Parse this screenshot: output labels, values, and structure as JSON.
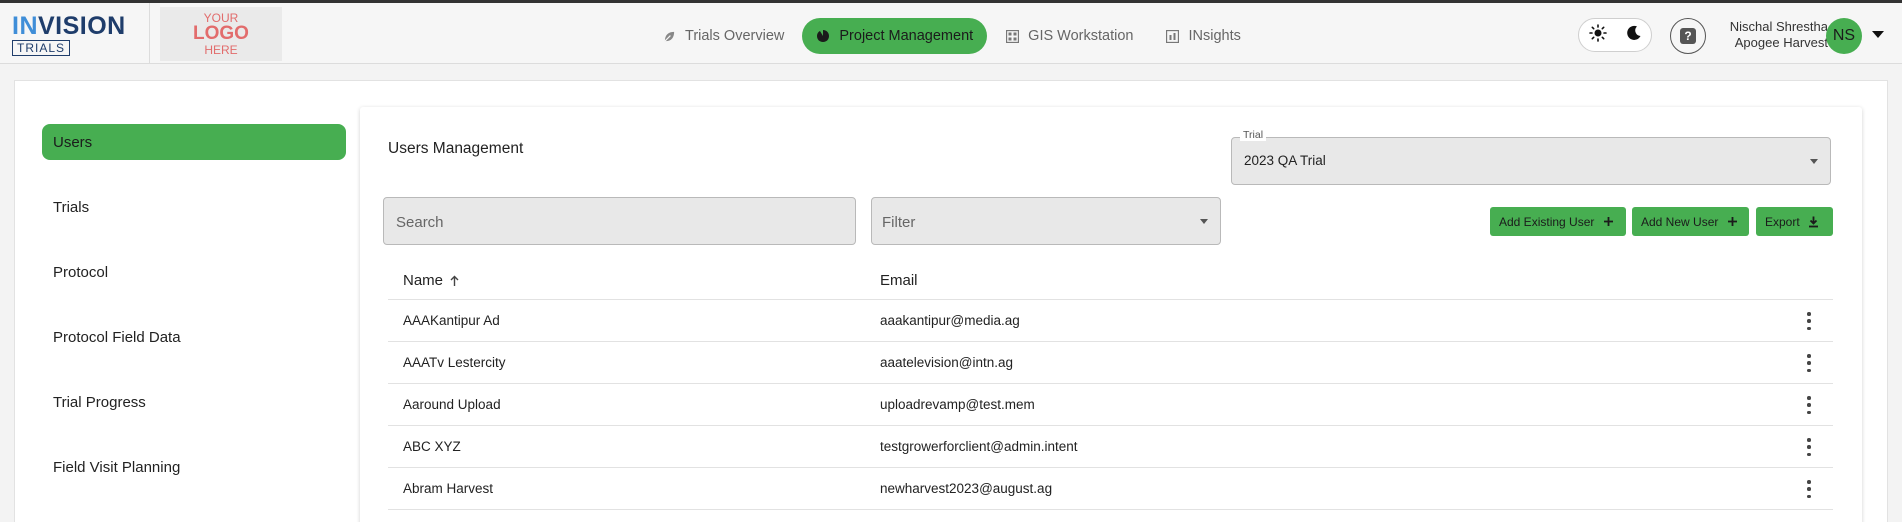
{
  "brand": {
    "name_prefix": "IN",
    "name_rest": "VISION",
    "sub": "TRIALS"
  },
  "logo_placeholder": {
    "line1": "YOUR",
    "line2": "LOGO",
    "line3": "HERE"
  },
  "nav": {
    "items": [
      {
        "label": "Trials Overview",
        "icon": "leaf-icon",
        "active": false
      },
      {
        "label": "Project Management",
        "icon": "project-icon",
        "active": true
      },
      {
        "label": "GIS Workstation",
        "icon": "grid-icon",
        "active": false
      },
      {
        "label": "INsights",
        "icon": "insights-icon",
        "active": false
      }
    ]
  },
  "user": {
    "name": "Nischal Shrestha",
    "org": "Apogee Harvest",
    "initials": "NS"
  },
  "sidebar": {
    "items": [
      {
        "label": "Users",
        "active": true
      },
      {
        "label": "Trials",
        "active": false
      },
      {
        "label": "Protocol",
        "active": false
      },
      {
        "label": "Protocol Field Data",
        "active": false
      },
      {
        "label": "Trial Progress",
        "active": false
      },
      {
        "label": "Field Visit Planning",
        "active": false
      }
    ]
  },
  "panel": {
    "title": "Users Management",
    "trial": {
      "label": "Trial",
      "value": "2023 QA Trial"
    },
    "search_placeholder": "Search",
    "filter_placeholder": "Filter",
    "buttons": {
      "add_existing": "Add Existing User",
      "add_new": "Add New User",
      "export": "Export"
    },
    "table": {
      "columns": {
        "name": "Name",
        "email": "Email"
      },
      "rows": [
        {
          "name": "AAAKantipur Ad",
          "email": "aaakantipur@media.ag"
        },
        {
          "name": "AAATv Lestercity",
          "email": "aaatelevision@intn.ag"
        },
        {
          "name": "Aaround Upload",
          "email": "uploadrevamp@test.mem"
        },
        {
          "name": "ABC XYZ",
          "email": "testgrowerforclient@admin.intent"
        },
        {
          "name": "Abram Harvest",
          "email": "newharvest2023@august.ag"
        }
      ]
    }
  },
  "colors": {
    "accent": "#47ae51",
    "brand_navy": "#1f3d6b",
    "brand_blue": "#3f8ed8",
    "logo_placeholder": "#e26c6c"
  }
}
